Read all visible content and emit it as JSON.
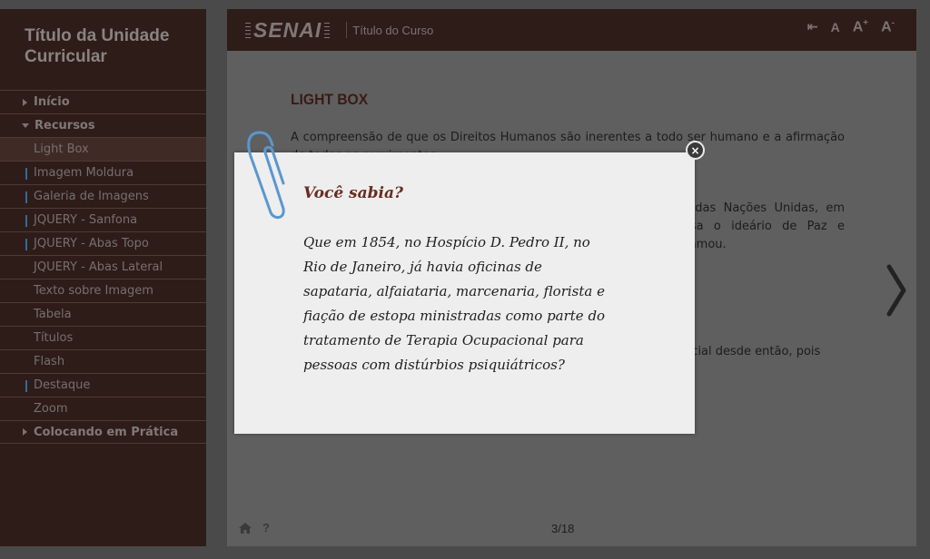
{
  "sidebar": {
    "unit_title": "Título da Unidade Curricular",
    "items": [
      {
        "label": "Início",
        "level": 1,
        "icon": "arrow-right",
        "mark": false,
        "active": false
      },
      {
        "label": "Recursos",
        "level": 1,
        "icon": "arrow-down",
        "mark": false,
        "active": false
      },
      {
        "label": "Light Box",
        "level": 2,
        "icon": "",
        "mark": false,
        "active": true
      },
      {
        "label": "Imagem Moldura",
        "level": 2,
        "icon": "",
        "mark": true,
        "active": false
      },
      {
        "label": "Galeria de Imagens",
        "level": 2,
        "icon": "",
        "mark": true,
        "active": false
      },
      {
        "label": "JQUERY - Sanfona",
        "level": 2,
        "icon": "",
        "mark": true,
        "active": false
      },
      {
        "label": "JQUERY - Abas Topo",
        "level": 2,
        "icon": "",
        "mark": true,
        "active": false
      },
      {
        "label": "JQUERY - Abas Lateral",
        "level": 2,
        "icon": "",
        "mark": false,
        "active": false
      },
      {
        "label": "Texto sobre Imagem",
        "level": 2,
        "icon": "",
        "mark": false,
        "active": false
      },
      {
        "label": "Tabela",
        "level": 2,
        "icon": "",
        "mark": false,
        "active": false
      },
      {
        "label": "Títulos",
        "level": 2,
        "icon": "",
        "mark": false,
        "active": false
      },
      {
        "label": "Flash",
        "level": 2,
        "icon": "",
        "mark": false,
        "active": false
      },
      {
        "label": "Destaque",
        "level": 2,
        "icon": "",
        "mark": true,
        "active": false
      },
      {
        "label": "Zoom",
        "level": 2,
        "icon": "",
        "mark": false,
        "active": false
      },
      {
        "label": "Colocando em Prática",
        "level": 1,
        "icon": "arrow-right",
        "mark": false,
        "active": false
      }
    ]
  },
  "header": {
    "logo_text": "SENAI",
    "course_title": "Título do Curso",
    "tools": {
      "back": "⇤",
      "font_normal": "A",
      "font_increase": "A",
      "font_increase_sup": "+",
      "font_decrease": "A",
      "font_decrease_sup": "-"
    }
  },
  "content": {
    "heading": "LIGHT BOX",
    "paragraphs": [
      "A compreensão de que os Direitos Humanos são inerentes a todo ser humano e a afirmação de todos os movimentos",
      "ral das Nações Unidas, em ressa o ideário de Paz e oclamou.",
      "rencial desde então, pois"
    ]
  },
  "footer": {
    "home_icon": "home-icon",
    "help_label": "?",
    "page": "3/18"
  },
  "lightbox": {
    "title": "Você sabia?",
    "text": "Que em 1854, no Hospício D. Pedro II, no Rio de Janeiro, já havia oficinas de sapataria, alfaiataria, marcenaria, florista e fiação de estopa ministradas como parte do tratamento de Terapia Ocupacional para pessoas com distúrbios psiquiátricos?",
    "close_label": "×"
  },
  "colors": {
    "sidebar_bg": "#2e1c19",
    "overlay": "#4a4a4a",
    "accent_mark": "#2f6a9a",
    "heading": "#3b1a14",
    "lightbox_title": "#6a2c21"
  }
}
